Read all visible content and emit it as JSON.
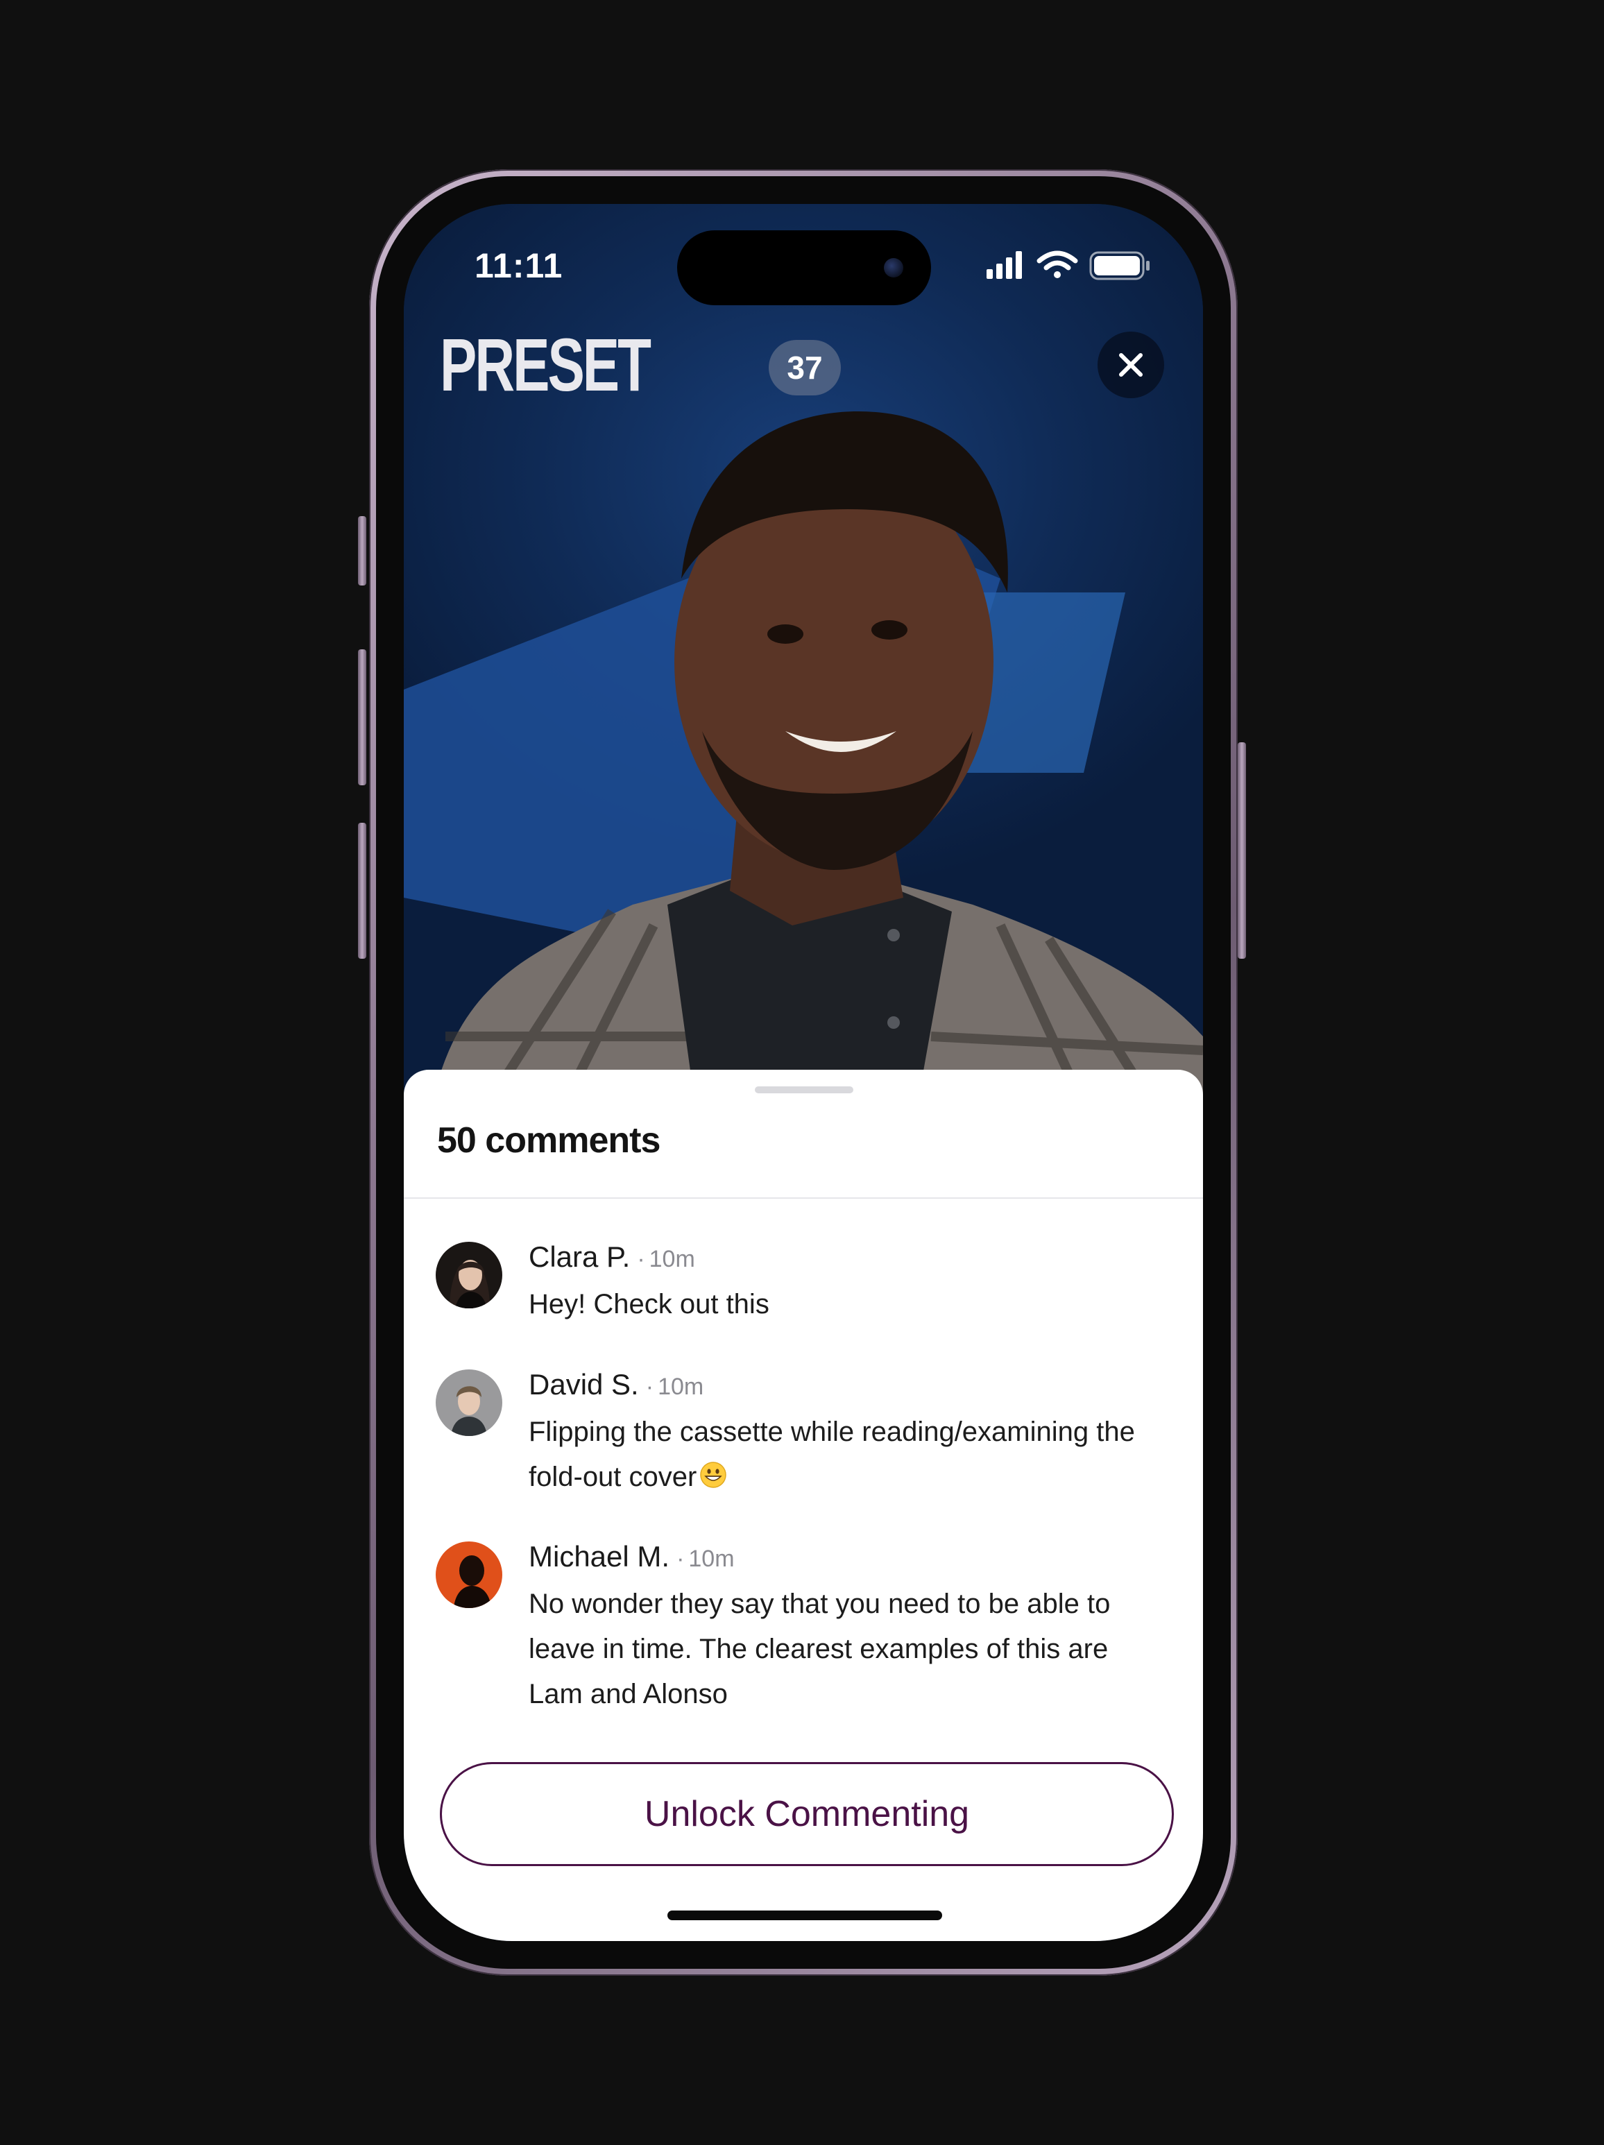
{
  "status_bar": {
    "time": "11:11",
    "icons": [
      "signal-icon",
      "wifi-icon",
      "battery-icon"
    ]
  },
  "header": {
    "brand": "PRESET",
    "viewer_count": "37",
    "close_icon": "close-icon"
  },
  "comments_sheet": {
    "title": "50 comments",
    "comments": [
      {
        "author": "Clara P.",
        "separator": "·",
        "time": "10m",
        "text": "Hey! Check out this"
      },
      {
        "author": "David S.",
        "separator": "·",
        "time": "10m",
        "text": "Flipping the cassette while reading/examining the fold-out cover",
        "emoji": "grinning-face-emoji"
      },
      {
        "author": "Michael M.",
        "separator": "·",
        "time": "10m",
        "text": "No wonder they say that you need to be able to leave in time. The clearest examples of this are Lam and Alonso"
      }
    ],
    "unlock_button_label": "Unlock Commenting"
  },
  "colors": {
    "accent": "#4a1246",
    "video_background": "#0f2a55",
    "sheet_background": "#ffffff",
    "page_background": "#101010"
  }
}
